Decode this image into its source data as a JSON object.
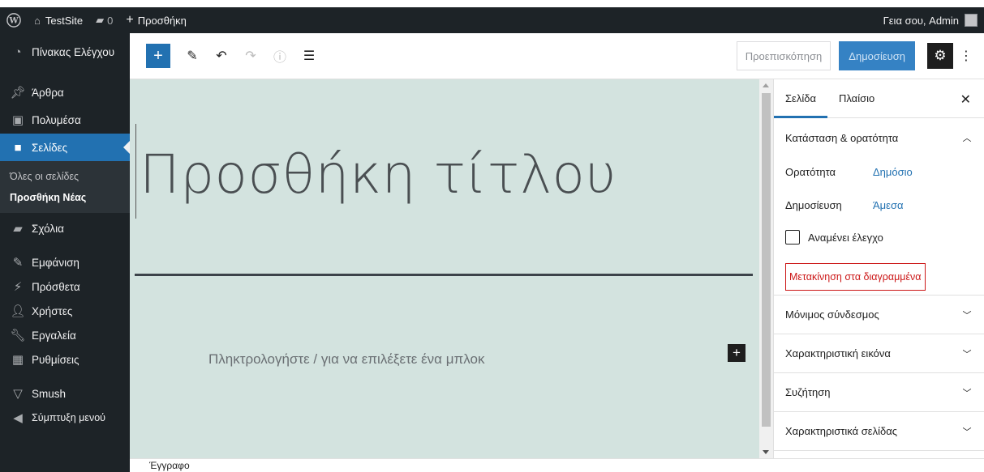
{
  "admin_bar": {
    "site_name": "TestSite",
    "comments_count": "0",
    "new_label": "Προσθήκη",
    "greeting": "Γεια σου, Admin"
  },
  "admin_menu": {
    "dashboard": "Πίνακας Ελέγχου",
    "posts": "Άρθρα",
    "media": "Πολυμέσα",
    "pages": "Σελίδες",
    "pages_sub": {
      "all": "Όλες οι σελίδες",
      "add_new": "Προσθήκη Νέας"
    },
    "comments": "Σχόλια",
    "appearance": "Εμφάνιση",
    "plugins": "Πρόσθετα",
    "users": "Χρήστες",
    "tools": "Εργαλεία",
    "settings": "Ρυθμίσεις",
    "smush": "Smush",
    "collapse": "Σύμπτυξη μενού"
  },
  "toolbar": {
    "preview": "Προεπισκόπηση",
    "publish": "Δημοσίευση"
  },
  "editor": {
    "title_placeholder": "Προσθήκη τίτλου",
    "block_placeholder": "Πληκτρολογήστε / για να επιλέξετε ένα μπλοκ"
  },
  "sidebar": {
    "tabs": [
      "Σελίδα",
      "Πλαίσιο"
    ],
    "status_panel": {
      "title": "Κατάσταση & ορατότητα",
      "visibility_label": "Ορατότητα",
      "visibility_value": "Δημόσιο",
      "publish_label": "Δημοσίευση",
      "publish_value": "Άμεσα",
      "pending_label": "Αναμένει έλεγχο",
      "trash_label": "Μετακίνηση στα διαγραμμένα"
    },
    "panels": [
      "Μόνιμος σύνδεσμος",
      "Χαρακτηριστική εικόνα",
      "Συζήτηση",
      "Χαρακτηριστικά σελίδας"
    ]
  },
  "footer": {
    "breadcrumb": "Έγγραφο"
  },
  "colors": {
    "accent": "#2271b1",
    "admin_bg": "#1d2327",
    "canvas_bg": "#d3e3df",
    "danger": "#cc1818"
  }
}
